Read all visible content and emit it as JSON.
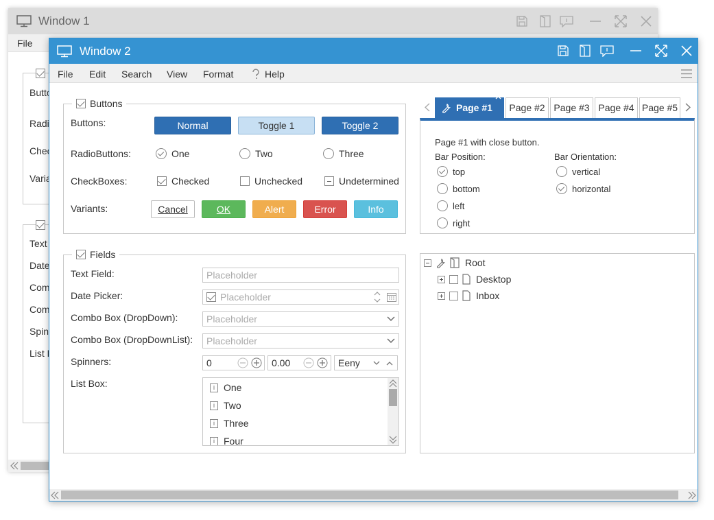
{
  "window1": {
    "title": "Window 1",
    "menu_file": "File",
    "labels": [
      "Butto",
      "Radio",
      "Chec",
      "Varia",
      "Text",
      "Date",
      "Comb",
      "Comb",
      "Spin",
      "List B"
    ]
  },
  "window2": {
    "title": "Window 2",
    "menu": [
      "File",
      "Edit",
      "Search",
      "View",
      "Format",
      "Help"
    ],
    "buttons_group": {
      "legend": "Buttons",
      "row_buttons": "Buttons:",
      "row_radio": "RadioButtons:",
      "row_check": "CheckBoxes:",
      "row_variants": "Variants:",
      "btn_normal": "Normal",
      "btn_toggle1": "Toggle 1",
      "btn_toggle2": "Toggle 2",
      "radio_one": "One",
      "radio_two": "Two",
      "radio_three": "Three",
      "check_checked": "Checked",
      "check_unchecked": "Unchecked",
      "check_undetermined": "Undetermined",
      "var_cancel": "Cancel",
      "var_ok": "OK",
      "var_alert": "Alert",
      "var_error": "Error",
      "var_info": "Info"
    },
    "fields_group": {
      "legend": "Fields",
      "lbl_text": "Text Field:",
      "lbl_date": "Date Picker:",
      "lbl_combo1": "Combo Box (DropDown):",
      "lbl_combo2": "Combo Box (DropDownList):",
      "lbl_spin": "Spinners:",
      "lbl_list": "List Box:",
      "text_placeholder": "Placeholder",
      "date_placeholder": "Placeholder",
      "combo1_placeholder": "Placeholder",
      "combo2_placeholder": "Placeholder",
      "spinner1_value": "0",
      "spinner2_value": "0.00",
      "spinner3_value": "Eeny",
      "list_items": [
        "One",
        "Two",
        "Three",
        "Four"
      ]
    },
    "tabs": {
      "items": [
        "Page #1",
        "Page #2",
        "Page #3",
        "Page #4",
        "Page #5"
      ],
      "active_index": 0,
      "content_title": "Page #1 with close button.",
      "bar_position_label": "Bar Position:",
      "bar_orientation_label": "Bar Orientation:",
      "positions": [
        "top",
        "bottom",
        "left",
        "right"
      ],
      "orientations": [
        "vertical",
        "horizontal"
      ],
      "selected_position": "top",
      "selected_orientation": "horizontal"
    },
    "tree": {
      "root": "Root",
      "children": [
        "Desktop",
        "Inbox"
      ]
    }
  },
  "colors": {
    "accent": "#3593d2",
    "button_blue": "#2f6fb3",
    "ok": "#5cb85c",
    "alert": "#f0ad4e",
    "error": "#d9534f",
    "info": "#5bc0de"
  }
}
